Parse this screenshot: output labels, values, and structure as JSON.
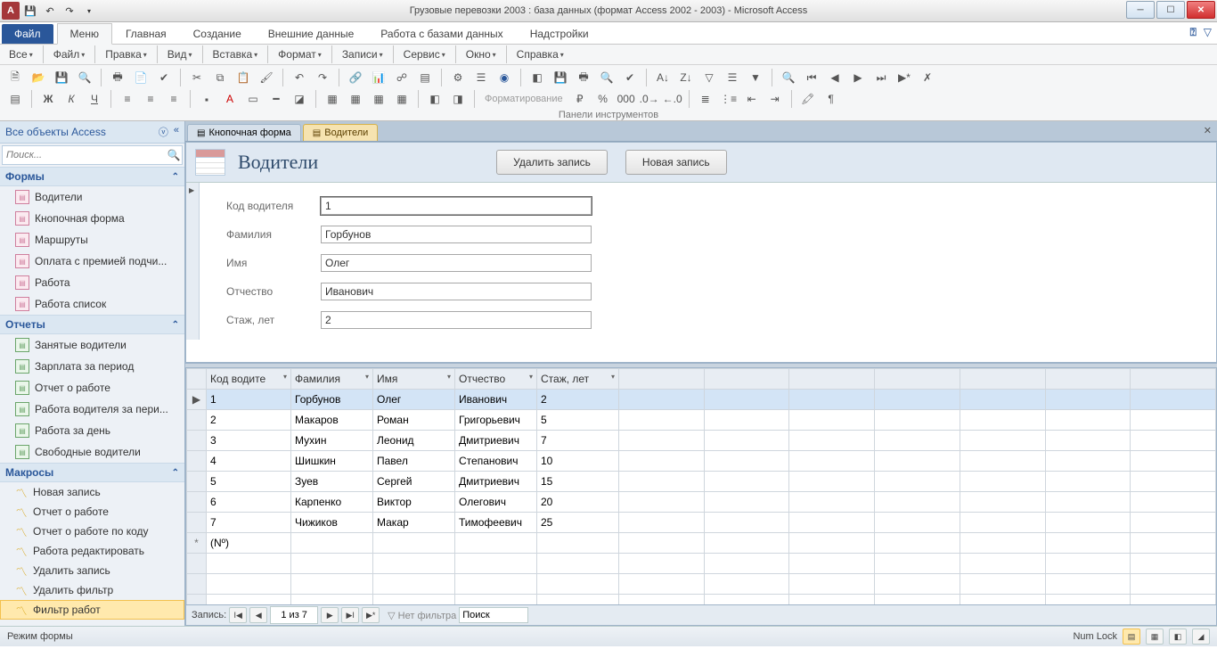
{
  "title_bar": {
    "title": "Грузовые перевозки 2003 : база данных (формат Access 2002 - 2003)  -  Microsoft Access"
  },
  "ribbon": {
    "file": "Файл",
    "tabs": [
      "Меню",
      "Главная",
      "Создание",
      "Внешние данные",
      "Работа с базами данных",
      "Надстройки"
    ],
    "active_tab": 0
  },
  "menu_row": [
    "Все",
    "Файл",
    "Правка",
    "Вид",
    "Вставка",
    "Формат",
    "Записи",
    "Сервис",
    "Окно",
    "Справка"
  ],
  "ribbon_group_label": "Панели инструментов",
  "formatting_label": "Форматирование",
  "nav": {
    "header": "Все объекты Access",
    "search_placeholder": "Поиск...",
    "groups": [
      {
        "title": "Формы",
        "type": "form",
        "items": [
          "Водители",
          "Кнопочная форма",
          "Маршруты",
          "Оплата с премией подчи...",
          "Работа",
          "Работа список"
        ]
      },
      {
        "title": "Отчеты",
        "type": "report",
        "items": [
          "Занятые водители",
          "Зарплата за период",
          "Отчет о работе",
          "Работа водителя за пери...",
          "Работа за день",
          "Свободные водители"
        ]
      },
      {
        "title": "Макросы",
        "type": "macro",
        "items": [
          "Новая запись",
          "Отчет о работе",
          "Отчет о работе по коду",
          "Работа редактировать",
          "Удалить запись",
          "Удалить фильтр",
          "Фильтр работ"
        ]
      }
    ]
  },
  "doc_tabs": {
    "tabs": [
      "Кнопочная форма",
      "Водители"
    ],
    "active": 1
  },
  "form": {
    "title": "Водители",
    "buttons": {
      "delete": "Удалить запись",
      "new": "Новая запись"
    },
    "fields": [
      {
        "label": "Код водителя",
        "value": "1"
      },
      {
        "label": "Фамилия",
        "value": "Горбунов"
      },
      {
        "label": "Имя",
        "value": "Олег"
      },
      {
        "label": "Отчество",
        "value": "Иванович"
      },
      {
        "label": "Стаж, лет",
        "value": "2"
      }
    ]
  },
  "datasheet": {
    "columns": [
      "Код водите",
      "Фамилия",
      "Имя",
      "Отчество",
      "Стаж, лет"
    ],
    "rows": [
      [
        "1",
        "Горбунов",
        "Олег",
        "Иванович",
        "2"
      ],
      [
        "2",
        "Макаров",
        "Роман",
        "Григорьевич",
        "5"
      ],
      [
        "3",
        "Мухин",
        "Леонид",
        "Дмитриевич",
        "7"
      ],
      [
        "4",
        "Шишкин",
        "Павел",
        "Степанович",
        "10"
      ],
      [
        "5",
        "Зуев",
        "Сергей",
        "Дмитриевич",
        "15"
      ],
      [
        "6",
        "Карпенко",
        "Виктор",
        "Олегович",
        "20"
      ],
      [
        "7",
        "Чижиков",
        "Макар",
        "Тимофеевич",
        "25"
      ]
    ],
    "new_row_label": "(Nº)"
  },
  "record_nav": {
    "label": "Запись:",
    "position": "1 из 7",
    "no_filter": "Нет фильтра",
    "search": "Поиск"
  },
  "status_bar": {
    "left": "Режим формы",
    "right": "Num Lock"
  }
}
